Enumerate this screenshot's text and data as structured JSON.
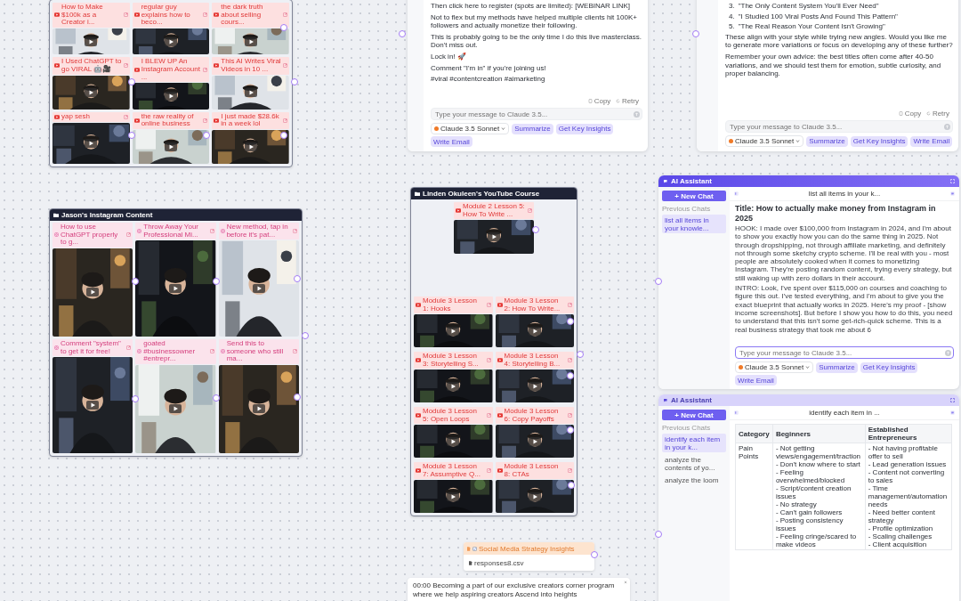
{
  "youtube_board": {
    "videos": [
      {
        "title": "How to Make $100k as a Creator i..."
      },
      {
        "title": "regular guy explains how to beco..."
      },
      {
        "title": "the dark truth about selling cours..."
      },
      {
        "title": "I Used ChatGPT to go VIRAL 🤖🎥"
      },
      {
        "title": "I BLEW UP An Instagram Account ..."
      },
      {
        "title": "This AI Writes Viral Videos in 10 ..."
      },
      {
        "title": "yap sesh"
      },
      {
        "title": "the raw reality of online business"
      },
      {
        "title": "I just made $28.6k in a week lol"
      }
    ]
  },
  "top_chats": [
    {
      "blocks": [
        {
          "kind": "paragraph",
          "text": "Then click here to register (spots are limited): [WEBINAR LINK]"
        },
        {
          "kind": "paragraph",
          "text": "Not to flex but my methods have helped multiple clients hit 100K+ followers and actually monetize their following."
        },
        {
          "kind": "paragraph",
          "text": "This is probably going to be the only time I do this live masterclass. Don't miss out."
        },
        {
          "kind": "paragraph",
          "text": "Lock in! 🚀"
        },
        {
          "kind": "paragraph",
          "text": "Comment \"I'm in\" if you're joining us!"
        },
        {
          "kind": "paragraph",
          "text": "#viral #contentcreation #aimarketing"
        }
      ],
      "actions": [
        "Copy",
        "Retry"
      ],
      "input": {
        "placeholder": "Type your message to Claude 3.5..."
      },
      "model": "Claude 3.5 Sonnet",
      "chips": [
        "Summarize",
        "Get Key Insights",
        "Write Email"
      ]
    },
    {
      "blocks": [
        {
          "kind": "numbered",
          "number": "3.",
          "text": "\"The Only Content System You'll Ever Need\""
        },
        {
          "kind": "numbered",
          "number": "4.",
          "text": "\"I Studied 100 Viral Posts And Found This Pattern\""
        },
        {
          "kind": "numbered",
          "number": "5.",
          "text": "\"The Real Reason Your Content Isn't Growing\""
        },
        {
          "kind": "paragraph",
          "text": "These align with your style while trying new angles. Would you like me to generate more variations or focus on developing any of these further?"
        },
        {
          "kind": "paragraph",
          "text": "Remember your own advice: the best titles often come after 40-50 variations, and we should test them for emotion, subtle curiosity, and proper balancing."
        }
      ],
      "actions": [
        "Copy",
        "Retry"
      ],
      "input": {
        "placeholder": "Type your message to Claude 3.5..."
      },
      "model": "Claude 3.5 Sonnet",
      "chips": [
        "Summarize",
        "Get Key Insights",
        "Write Email"
      ]
    }
  ],
  "instagram_board": {
    "title": "Jason's Instagram Content",
    "posts": [
      {
        "title": "How to use ChatGPT properly to g..."
      },
      {
        "title": "Throw Away Your Professional Mi..."
      },
      {
        "title": "New method, tap in before it's pat..."
      },
      {
        "title": "Comment \"system\" to get it for free!"
      },
      {
        "title": "goated #businessowner #entrepr..."
      },
      {
        "title": "Send this to someone who still ma..."
      }
    ]
  },
  "course_board": {
    "title": "Linden Okuleen's YouTube Course",
    "videos": [
      {
        "title": "Module 2 Lesson 5: How To Write ..."
      },
      {
        "title": "Module 3 Lesson 1: Hooks"
      },
      {
        "title": "Module 3 Lesson 2: How To Write..."
      },
      {
        "title": "Module 3 Lesson 3: Storytelling S..."
      },
      {
        "title": "Module 3 Lesson 4: Storytelling B..."
      },
      {
        "title": "Module 3 Lesson 5: Open Loops"
      },
      {
        "title": "Module 3 Lesson 6: Copy Payoffs"
      },
      {
        "title": "Module 3 Lesson 7: Assumptive Q..."
      },
      {
        "title": "Module 3 Lesson 8: CTAs"
      }
    ]
  },
  "assistants": [
    {
      "title": "AI Assistant",
      "active": true,
      "new_chat": "+ New Chat",
      "history_label": "Previous Chats",
      "history": [
        {
          "label": "list all items in your knowle...",
          "selected": true
        }
      ],
      "conversation_title": "list all items in your k...",
      "content": {
        "kind": "document",
        "heading": "Title: How to actually make money from Instagram in 2025",
        "paragraphs": [
          "HOOK: I made over $100,000 from Instagram in 2024, and I'm about to show you exactly how you can do the same thing in 2025. Not through dropshipping, not through affiliate marketing, and definitely not through some sketchy crypto scheme. I'll be real with you - most people are absolutely cooked when it comes to monetizing Instagram. They're posting random content, trying every strategy, but still waking up with zero dollars in their account.",
          "INTRO: Look, I've spent over $115,000 on courses and coaching to figure this out. I've tested everything, and I'm about to give you the exact blueprint that actually works in 2025. Here's my proof - [show income screenshots]. But before I show you how to do this, you need to understand that this isn't some get-rich-quick scheme. This is a real business strategy that took me about 6"
        ]
      },
      "input": {
        "placeholder": "Type your message to Claude 3.5..."
      },
      "model": "Claude 3.5 Sonnet",
      "chips": [
        "Summarize",
        "Get Key Insights",
        "Write Email"
      ]
    },
    {
      "title": "AI Assistant",
      "active": false,
      "new_chat": "+ New Chat",
      "history_label": "Previous Chats",
      "history": [
        {
          "label": "identify each item in your k...",
          "selected": true
        },
        {
          "label": "analyze the contents of yo...",
          "selected": false
        },
        {
          "label": "analyze the loom",
          "selected": false
        }
      ],
      "conversation_title": "identify each item in ...",
      "content": {
        "kind": "table",
        "columns": [
          "Category",
          "Beginners",
          "Established Entrepreneurs"
        ],
        "rows": [
          {
            "cells": [
              [
                "Pain Points"
              ],
              [
                "- Not getting views/engagement/traction",
                "- Don't know where to start",
                "- Feeling overwhelmed/blocked",
                "- Script/content creation issues",
                "- No strategy",
                "- Can't gain followers",
                "- Posting consistency issues",
                "- Feeling cringe/scared to make videos"
              ],
              [
                "- Not having profitable offer to sell",
                "- Lead generation issues",
                "- Content not converting to sales",
                "- Time management/automation needs",
                "- Need better content strategy",
                "- Profile optimization",
                "- Scaling challenges",
                "- Client acquisition"
              ]
            ]
          }
        ]
      }
    }
  ],
  "file_node": {
    "title": "Social Media Strategy Insights",
    "file": "responses8.csv"
  },
  "transcript": {
    "text": "00:00 Becoming a part of our exclusive creators corner program where we help aspiring creators Ascend into heights"
  }
}
